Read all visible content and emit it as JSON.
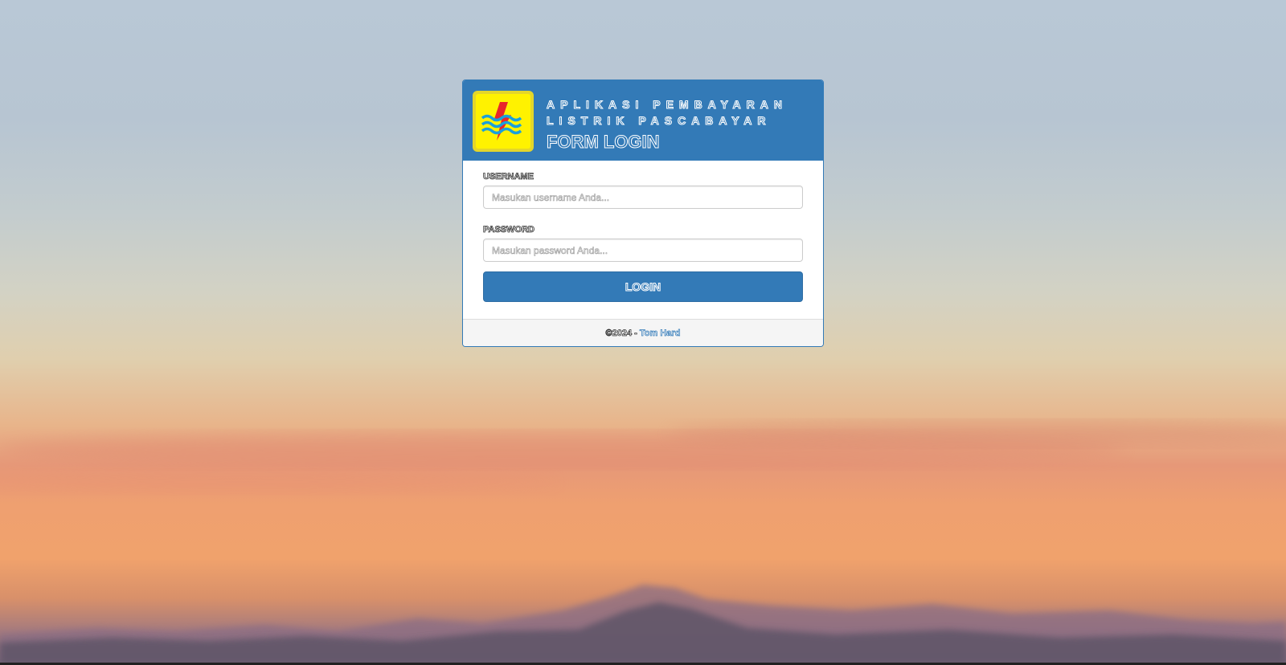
{
  "login_panel": {
    "app_title_line1": "APLIKASI PEMBAYARAN",
    "app_title_line2": "LISTRIK PASCABAYAR",
    "form_title": "FORM LOGIN",
    "username": {
      "label": "USERNAME",
      "placeholder": "Masukan username Anda...",
      "value": ""
    },
    "password": {
      "label": "PASSWORD",
      "placeholder": "Masukan password Anda...",
      "value": ""
    },
    "login_button": "LOGIN",
    "footer": {
      "copyright": "©2024 - ",
      "author": "Tom Hard"
    }
  },
  "colors": {
    "primary": "#337ab7",
    "logo_yellow": "#fff200",
    "logo_red": "#e8262b",
    "logo_blue": "#1aa0dc"
  },
  "icons": {
    "logo": "pln-lightning-waves-logo"
  }
}
